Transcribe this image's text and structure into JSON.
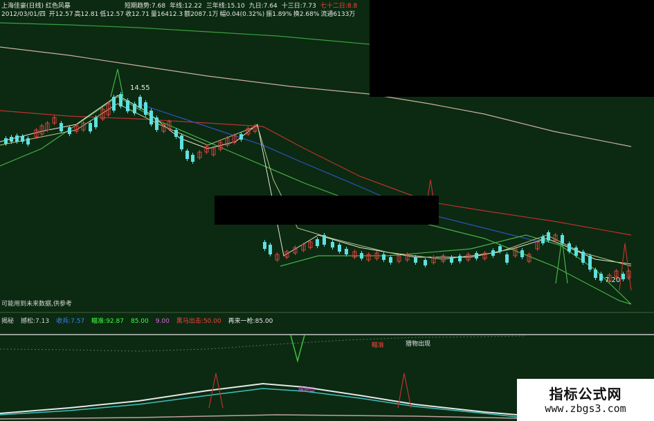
{
  "header": {
    "stock_name": "上海佳豪(日线)",
    "indicator_name": "红色风暴",
    "row3": [
      {
        "label": "短期趋势:",
        "value": "7.68",
        "color": "#e8e8e8"
      },
      {
        "label": "年线:",
        "value": "12.22",
        "color": "#e8e8e8"
      },
      {
        "label": "三年线:",
        "value": "15.10",
        "color": "#e8e8e8"
      },
      {
        "label": "九日:",
        "value": "7.64",
        "color": "#e8e8e8"
      },
      {
        "label": "十三日:",
        "value": "7.73",
        "color": "#e8e8e8"
      },
      {
        "label": "七十二日:",
        "value": "8.8",
        "color": "#ff4040"
      }
    ],
    "date": "2012/03/01/四",
    "quote": [
      {
        "label": "开",
        "value": "12.57"
      },
      {
        "label": "高",
        "value": "12.81"
      },
      {
        "label": "低",
        "value": "12.57"
      },
      {
        "label": "收",
        "value": "12.71"
      },
      {
        "label": "量",
        "value": "16412.3"
      },
      {
        "label": "额",
        "value": "2087.1万"
      },
      {
        "label": "幅",
        "value": "0.04(0.32%)"
      },
      {
        "label": "振",
        "value": "1.89%"
      },
      {
        "label": "换",
        "value": "2.68%"
      },
      {
        "label": "流通",
        "value": "6133万"
      }
    ]
  },
  "chart": {
    "high_label": "14.55",
    "low_label": "7.20"
  },
  "note": "可能用到未来数据,供参考",
  "oscillator": {
    "items": [
      {
        "label": "揭秘",
        "value": "",
        "color": "#d8d8d8"
      },
      {
        "label": "撼松:",
        "value": "7.13",
        "color": "#d8d8d8"
      },
      {
        "label": "收兵:",
        "value": "7.57",
        "color": "#4080ff"
      },
      {
        "label": "瞄准:",
        "value": "92.87",
        "color": "#40ff40"
      },
      {
        "label": "",
        "value": "85.00",
        "color": "#40ff40"
      },
      {
        "label": "",
        "value": "9.00",
        "color": "#e060e0"
      },
      {
        "label": "黑马出击:",
        "value": "50.00",
        "color": "#ff4040"
      },
      {
        "label": "再来一枪:",
        "value": "85.00",
        "color": "#e8e8e8"
      }
    ],
    "signal_label": "猎物出现",
    "signal_red": "瞄准",
    "signal_purple": "猎物出"
  },
  "watermark": {
    "title": "指标公式网",
    "url": "www.zbgs3.com"
  }
}
